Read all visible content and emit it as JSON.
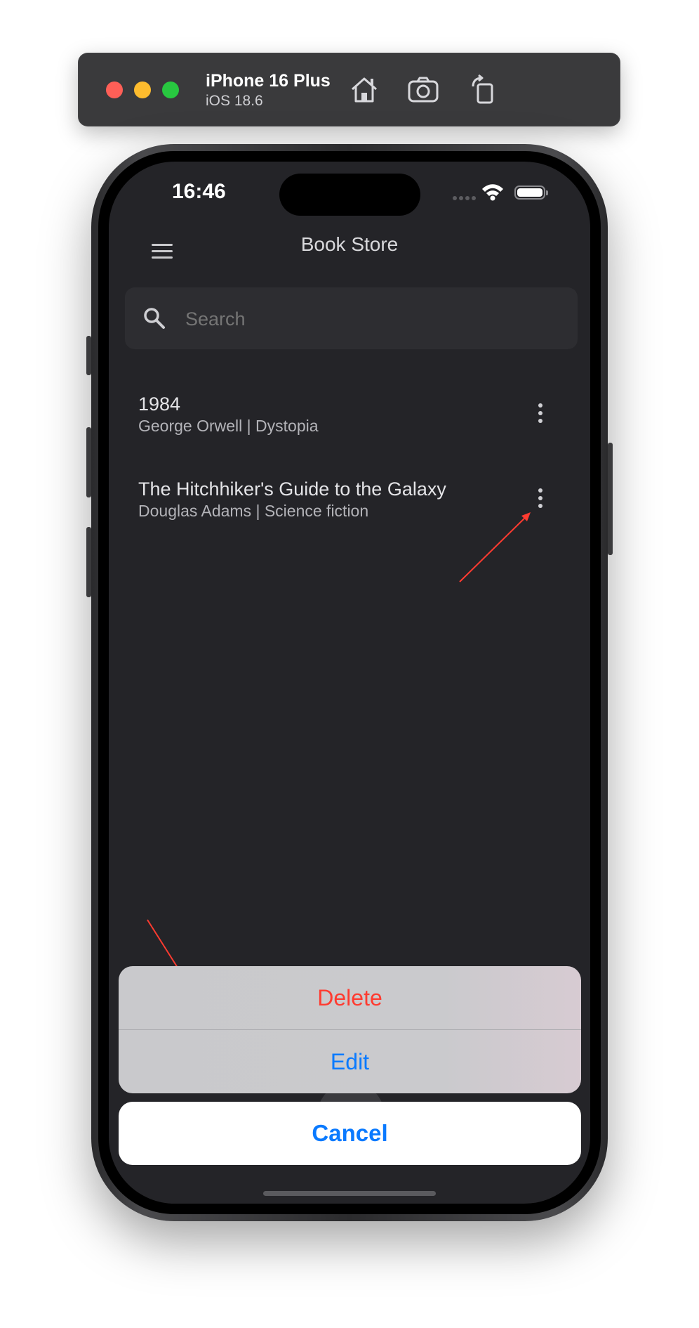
{
  "simulator": {
    "device_name": "iPhone 16 Plus",
    "os_version": "iOS 18.6",
    "toolbar_icons": [
      "home-icon",
      "screenshot-icon",
      "rotate-icon"
    ],
    "traffic_light_colors": [
      "#ff5f57",
      "#febc2e",
      "#28c840"
    ]
  },
  "status_bar": {
    "time": "16:46"
  },
  "app": {
    "title": "Book Store",
    "search_placeholder": "Search",
    "books": [
      {
        "title": "1984",
        "subtitle": "George Orwell | Dystopia"
      },
      {
        "title": "The Hitchhiker's Guide to the Galaxy",
        "subtitle": "Douglas Adams | Science fiction"
      }
    ]
  },
  "action_sheet": {
    "delete_label": "Delete",
    "edit_label": "Edit",
    "cancel_label": "Cancel"
  },
  "colors": {
    "screen_background": "#242428",
    "destructive": "#ff3b30",
    "accent": "#0a7aff",
    "annotation_arrow": "#ff3b30"
  }
}
